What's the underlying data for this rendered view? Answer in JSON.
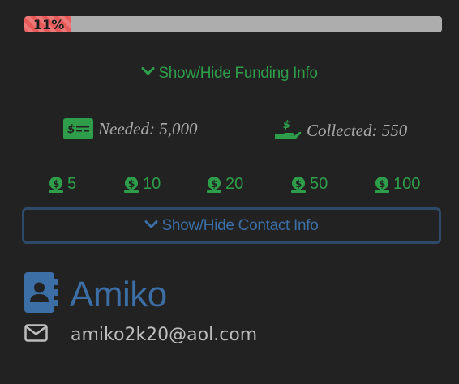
{
  "progress": {
    "percent": 11,
    "label": "11%",
    "fill_color": "#e85a5a",
    "track_color": "#adadad"
  },
  "funding": {
    "toggle_label": "Show/Hide Funding Info",
    "toggle_icon": "chevron-down-icon",
    "needed_label": "Needed: 5,000",
    "needed_icon": "money-bill-icon",
    "collected_label": "Collected: 550",
    "collected_icon": "hand-holding-dollar-icon",
    "accent_color": "#2f9e4b"
  },
  "donations": {
    "icon": "coin-dollar-icon",
    "amounts": [
      "5",
      "10",
      "20",
      "50",
      "100"
    ]
  },
  "contact": {
    "toggle_label": "Show/Hide Contact Info",
    "toggle_icon": "chevron-down-icon",
    "name": "Amiko",
    "name_icon": "address-book-icon",
    "email": "amiko2k20@aol.com",
    "email_icon": "envelope-icon",
    "accent_color": "#3c6fa6"
  }
}
